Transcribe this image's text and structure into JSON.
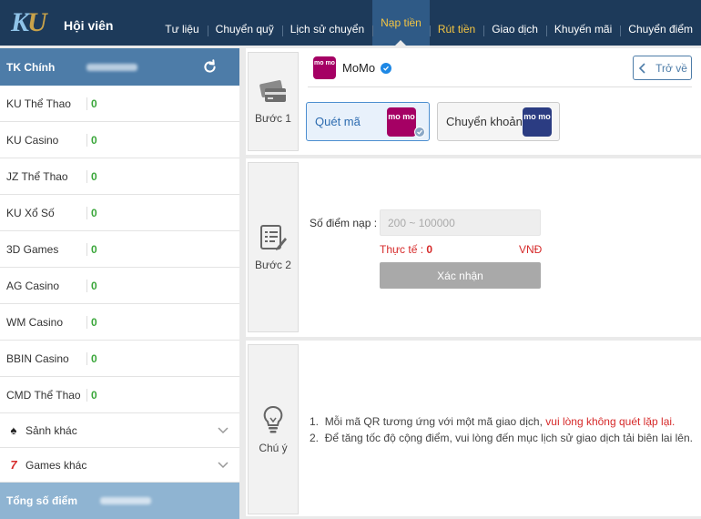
{
  "header": {
    "logo": "KU",
    "title": "Hội viên",
    "nav": [
      {
        "label": "Tư liệu",
        "state": "normal"
      },
      {
        "label": "Chuyển quỹ",
        "state": "normal"
      },
      {
        "label": "Lịch sử chuyển",
        "state": "normal"
      },
      {
        "label": "Nạp tiền",
        "state": "active"
      },
      {
        "label": "Rút tiền",
        "state": "gold"
      },
      {
        "label": "Giao dịch",
        "state": "normal"
      },
      {
        "label": "Khuyến mãi",
        "state": "normal"
      },
      {
        "label": "Chuyển điểm",
        "state": "normal"
      }
    ]
  },
  "sidebar": {
    "main_account": "TK Chính",
    "rows": [
      {
        "name": "KU Thể Thao",
        "value": "0"
      },
      {
        "name": "KU Casino",
        "value": "0"
      },
      {
        "name": "JZ Thể Thao",
        "value": "0"
      },
      {
        "name": "KU Xổ Số",
        "value": "0"
      },
      {
        "name": "3D Games",
        "value": "0"
      },
      {
        "name": "AG Casino",
        "value": "0"
      },
      {
        "name": "WM Casino",
        "value": "0"
      },
      {
        "name": "BBIN Casino",
        "value": "0"
      },
      {
        "name": "CMD Thể Thao",
        "value": "0"
      }
    ],
    "groups": [
      {
        "label": "Sảnh khác",
        "icon": "spade-icon"
      },
      {
        "label": "Games khác",
        "icon": "seven-icon"
      }
    ],
    "total_label": "Tổng số điểm"
  },
  "step1": {
    "label": "Bước 1",
    "provider": "MoMo",
    "provider_logo": "mo mo",
    "back": "Trở về",
    "options": [
      {
        "label": "Quét mã",
        "logo": "mo mo",
        "selected": true
      },
      {
        "label": "Chuyển khoản",
        "logo": "mo mo",
        "selected": false
      }
    ]
  },
  "step2": {
    "label": "Bước 2",
    "amount_label": "Số điểm nạp :",
    "amount_placeholder": "200 ~ 100000",
    "actual_label": "Thực tế :",
    "actual_value": "0",
    "currency": "VNĐ",
    "confirm": "Xác nhận"
  },
  "step3": {
    "label": "Chú ý",
    "note1_num": "1.",
    "note1_text": "Mỗi mã QR tương ứng với một mã giao dịch,",
    "note1_red": "vui lòng không quét lặp lại.",
    "note2_num": "2.",
    "note2_text": "Để tăng tốc độ cộng điểm, vui lòng đến mục lịch sử giao dịch tải biên lai lên."
  },
  "colors": {
    "header_bg": "#1d3a5a",
    "accent": "#4d7ca8",
    "momo": "#a50064",
    "momo_alt": "#2b3c82",
    "warning": "#d62a2a",
    "success": "#3aa63a"
  }
}
